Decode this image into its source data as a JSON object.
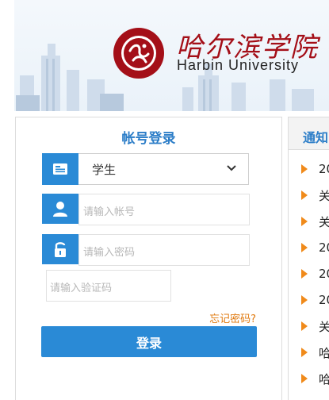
{
  "header": {
    "brand_cn": "哈尔滨学院",
    "brand_en": "Harbin University",
    "logo_ring_top": "哈尔滨学院",
    "logo_ring_bottom": "HARBIN UNIVERSITY"
  },
  "login": {
    "title": "帐号登录",
    "role_value": "学生",
    "account_placeholder": "请输入帐号",
    "password_placeholder": "请输入密码",
    "captcha_placeholder": "请输入验证码",
    "forgot_label": "忘记密码?",
    "submit_label": "登录"
  },
  "notices": {
    "title": "通知",
    "items": [
      "20",
      "关",
      "关",
      "20",
      "20",
      "20",
      "关",
      "哈",
      "哈"
    ]
  },
  "colors": {
    "accent": "#2a8ad6",
    "title_blue": "#2d7ec8",
    "forgot_orange": "#e07a10",
    "bullet_orange": "#f08a1a",
    "logo_red": "#a40f18"
  }
}
